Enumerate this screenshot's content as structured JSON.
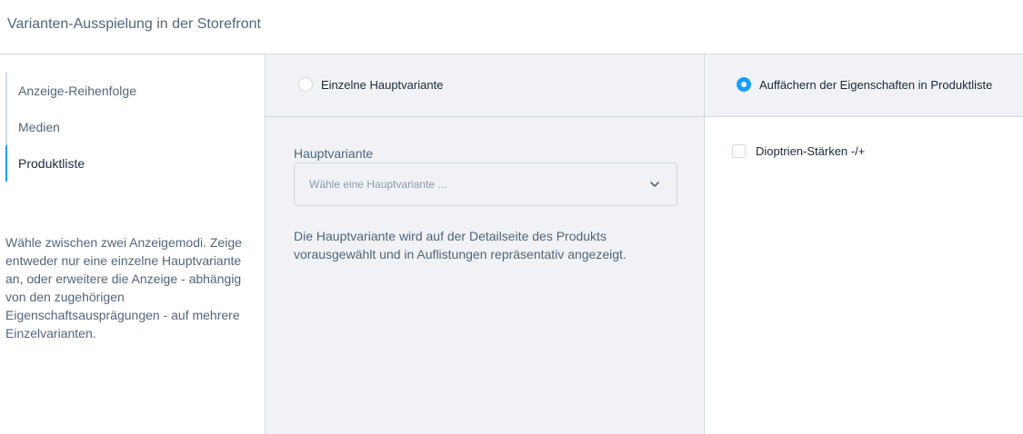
{
  "header": {
    "title": "Varianten-Ausspielung in der Storefront"
  },
  "sidebar": {
    "items": [
      {
        "label": "Anzeige-Reihenfolge",
        "active": false
      },
      {
        "label": "Medien",
        "active": false
      },
      {
        "label": "Produktliste",
        "active": true
      }
    ],
    "description": "Wähle zwischen zwei Anzeigemodi. Zeige entweder nur eine einzelne Hauptvariante an, oder erweitere die Anzeige - abhängig von den zugehörigen Eigenschaftsausprägungen - auf mehrere Einzelvarianten."
  },
  "modes": {
    "single": {
      "label": "Einzelne Hauptvariante",
      "checked": false
    },
    "expand": {
      "label": "Auffächern der Eigenschaften in Produktliste",
      "checked": true
    }
  },
  "main_variant": {
    "label": "Hauptvariante",
    "placeholder": "Wähle eine Hauptvariante ...",
    "help": "Die Hauptvariante wird auf der Detailseite des Produkts vorausgewählt und in Auflistungen repräsentativ angezeigt."
  },
  "properties": [
    {
      "label": "Dioptrien-Stärken -/+",
      "checked": false
    }
  ],
  "colors": {
    "accent": "#189eff",
    "border": "#d1d9e0",
    "panel_bg": "#f0f2f5",
    "text": "#52667a"
  },
  "icons": {
    "select_toggle": "chevron-down-icon"
  }
}
